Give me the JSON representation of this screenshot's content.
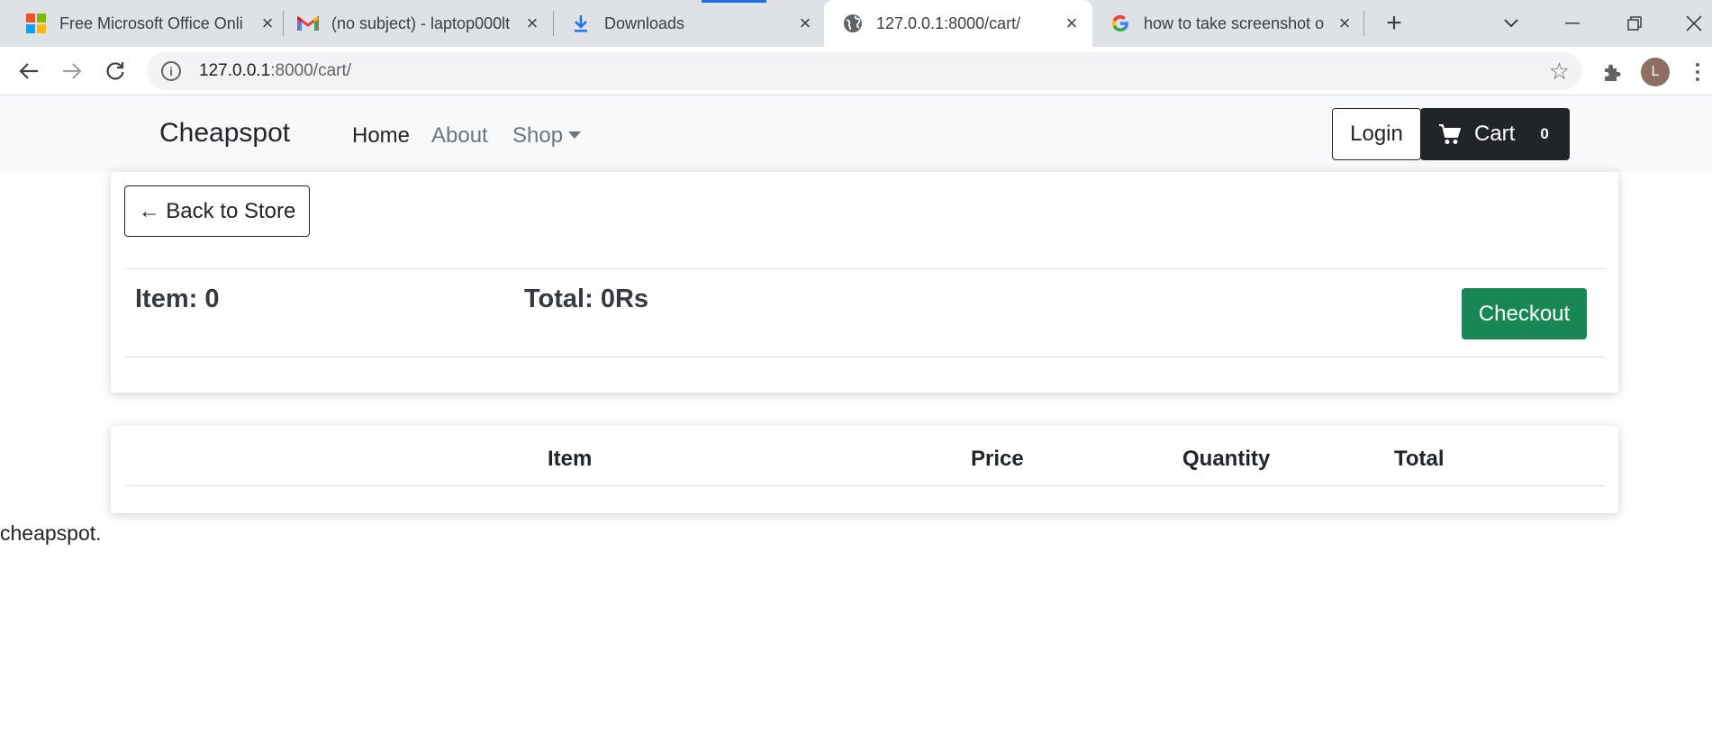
{
  "browser": {
    "tabs": [
      {
        "title": "Free Microsoft Office Onli",
        "favicon": "microsoft-icon"
      },
      {
        "title": "(no subject) - laptop000lt",
        "favicon": "gmail-icon"
      },
      {
        "title": "Downloads",
        "favicon": "download-icon"
      },
      {
        "title": "127.0.0.1:8000/cart/",
        "favicon": "globe-icon",
        "active": true
      },
      {
        "title": "how to take screenshot o",
        "favicon": "google-icon"
      }
    ],
    "url_host": "127.0.0.1",
    "url_rest": ":8000/cart/",
    "profile_initial": "L"
  },
  "navbar": {
    "brand": "Cheapspot",
    "links": [
      "Home",
      "About",
      "Shop"
    ],
    "login_label": "Login",
    "cart_label": "Cart",
    "cart_count": "0"
  },
  "summary_box": {
    "back_label": "← Back to Store",
    "items_label": "Item:",
    "items_value": "0",
    "total_label": "Total:",
    "total_value": "0Rs",
    "checkout_label": "Checkout"
  },
  "table": {
    "headers": [
      "Item",
      "Price",
      "Quantity",
      "Total"
    ]
  },
  "footer": {
    "text": "cheapspot."
  },
  "colors": {
    "checkout": "#198754",
    "cart_button": "#212529",
    "navbar_bg": "#f8f9fa",
    "chrome_tabstrip": "#dee1e6"
  }
}
